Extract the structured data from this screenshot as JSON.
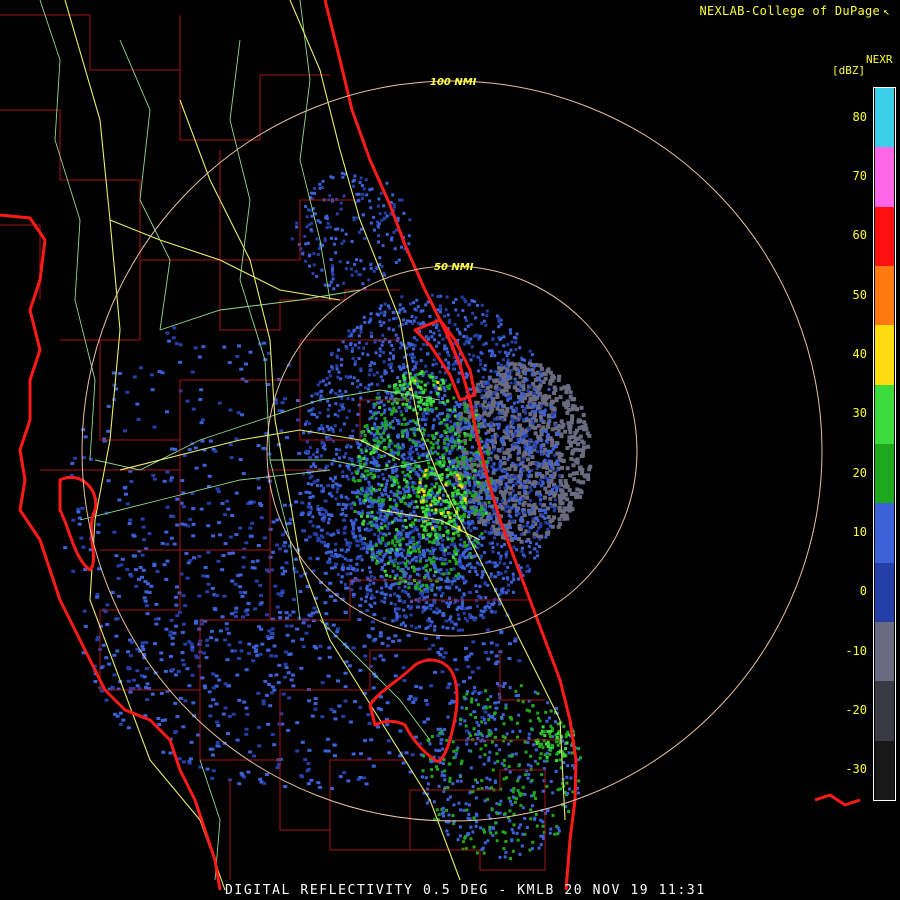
{
  "header": {
    "credit": "NEXLAB-College of DuPage",
    "credit_icon": "cursor-arrow-icon"
  },
  "footer": {
    "product_line": "DIGITAL REFLECTIVITY 0.5 DEG - KMLB 20 NOV 19 11:31"
  },
  "range_rings": [
    {
      "label": "100 NMI",
      "nmi": 100
    },
    {
      "label": "50 NMI",
      "nmi": 50
    }
  ],
  "legend": {
    "title": "NEXR",
    "unit": "[dBZ]",
    "ticks": [
      "80",
      "70",
      "60",
      "50",
      "40",
      "30",
      "20",
      "10",
      "0",
      "-10",
      "-20",
      "-30"
    ],
    "bands": [
      {
        "from": 75,
        "to": 85,
        "color": "#39cfe8"
      },
      {
        "from": 65,
        "to": 75,
        "color": "#ff66e8"
      },
      {
        "from": 55,
        "to": 65,
        "color": "#ff1010"
      },
      {
        "from": 45,
        "to": 55,
        "color": "#ff7a10"
      },
      {
        "from": 35,
        "to": 45,
        "color": "#ffdd10"
      },
      {
        "from": 25,
        "to": 35,
        "color": "#3ddc3d"
      },
      {
        "from": 15,
        "to": 25,
        "color": "#1ea81e"
      },
      {
        "from": 5,
        "to": 15,
        "color": "#3b62d8"
      },
      {
        "from": -5,
        "to": 5,
        "color": "#243fa8"
      },
      {
        "from": -15,
        "to": -5,
        "color": "#6a6a80"
      },
      {
        "from": -25,
        "to": -15,
        "color": "#3a3a44"
      },
      {
        "from": -35,
        "to": -25,
        "color": "#181818"
      }
    ]
  },
  "colors": {
    "coastline": "#ff1a1a",
    "county_lines": "#a31414",
    "highways": "#e8ef6a",
    "minor_roads": "#8fdb8f",
    "range_ring": "#e8c0a0"
  }
}
